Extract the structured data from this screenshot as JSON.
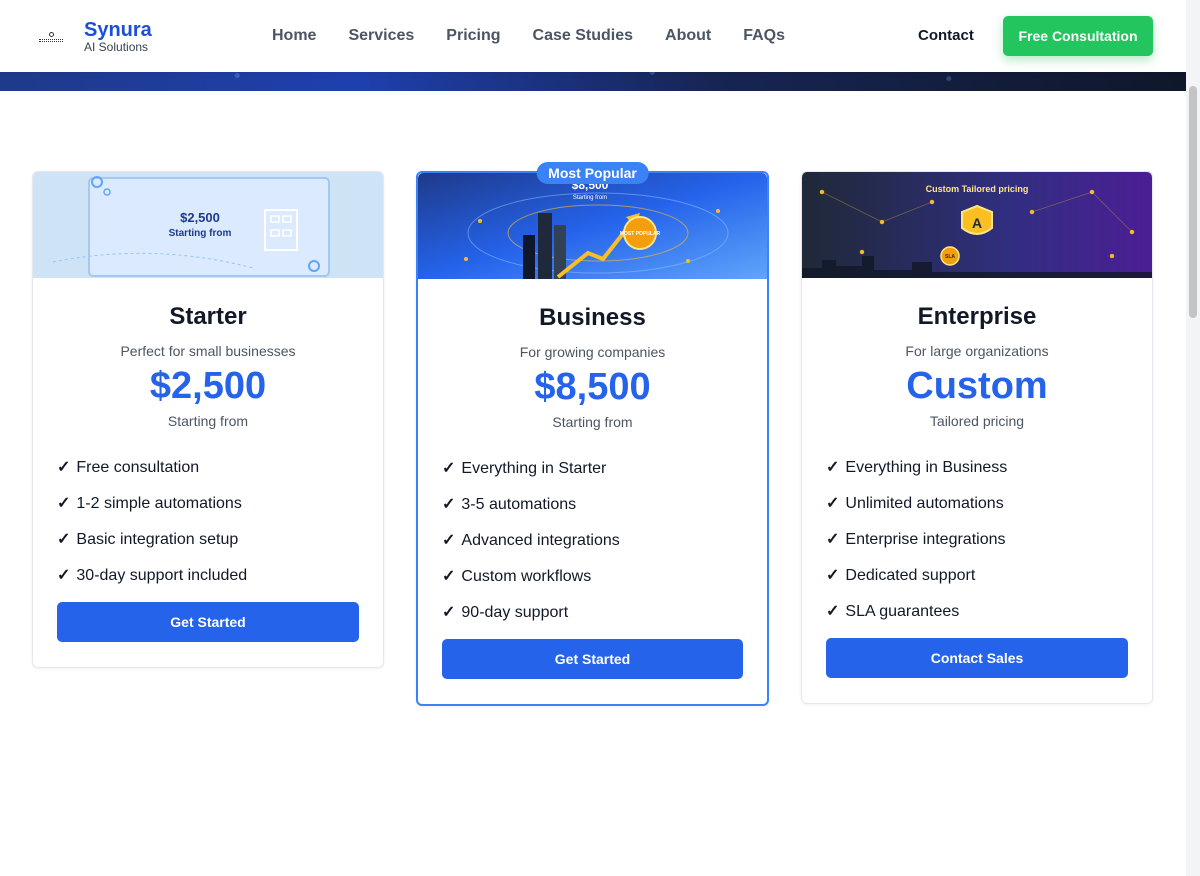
{
  "brand": {
    "name": "Synura",
    "tagline": "AI Solutions"
  },
  "nav": {
    "items": [
      {
        "label": "Home"
      },
      {
        "label": "Services"
      },
      {
        "label": "Pricing"
      },
      {
        "label": "Case Studies"
      },
      {
        "label": "About"
      },
      {
        "label": "FAQs"
      }
    ],
    "contact_label": "Contact",
    "cta_label": "Free Consultation"
  },
  "colors": {
    "brand": "#1d4ed8",
    "accent": "#2563eb",
    "cta_green": "#22c55e"
  },
  "plans": [
    {
      "name": "Starter",
      "description": "Perfect for small businesses",
      "price": "$2,500",
      "price_note": "Starting from",
      "image": {
        "price": "$2,500",
        "caption": "Starting from"
      },
      "features": [
        "Free consultation",
        "1-2 simple automations",
        "Basic integration setup",
        "30-day support included"
      ],
      "button_label": "Get Started"
    },
    {
      "name": "Business",
      "badge": "Most Popular",
      "description": "For growing companies",
      "price": "$8,500",
      "price_note": "Starting from",
      "image": {
        "price": "$8,500",
        "caption": "Starting from",
        "seal": "MOST POPULAR"
      },
      "features": [
        "Everything in Starter",
        "3-5 automations",
        "Advanced integrations",
        "Custom workflows",
        "90-day support"
      ],
      "button_label": "Get Started"
    },
    {
      "name": "Enterprise",
      "description": "For large organizations",
      "price": "Custom",
      "price_note": "Tailored pricing",
      "image": {
        "caption": "Custom Tailored pricing",
        "shield_letter": "A",
        "seal": "SLA"
      },
      "features": [
        "Everything in Business",
        "Unlimited automations",
        "Enterprise integrations",
        "Dedicated support",
        "SLA guarantees"
      ],
      "button_label": "Contact Sales"
    }
  ],
  "check_glyph": "✓"
}
